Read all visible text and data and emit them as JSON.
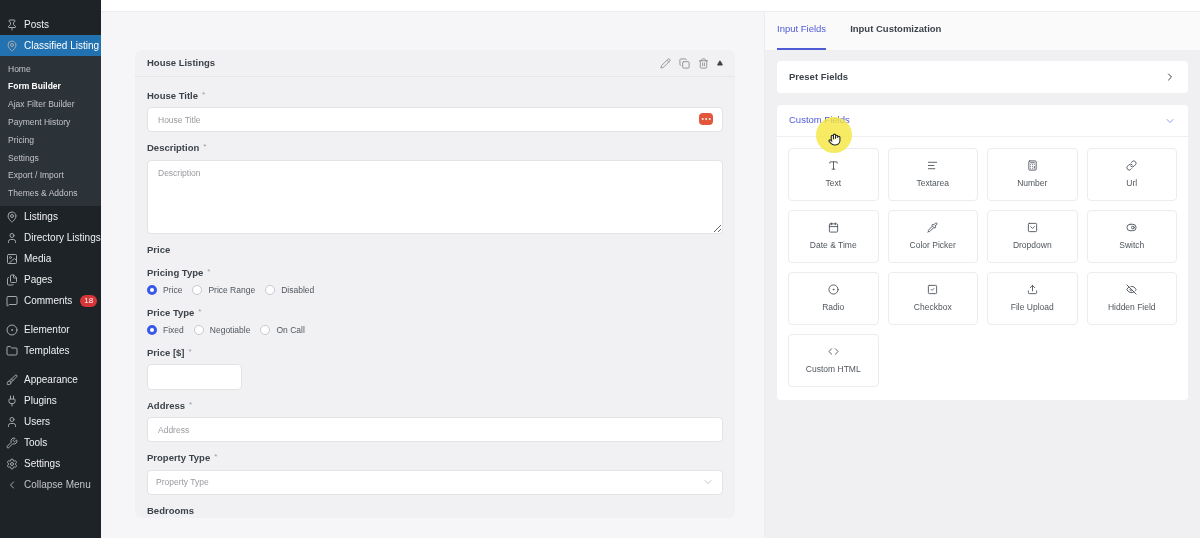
{
  "sidebar": {
    "items": [
      {
        "label": "Posts",
        "selected": false
      },
      {
        "label": "Classified Listing",
        "selected": true,
        "children": [
          {
            "label": "Home",
            "selected": false
          },
          {
            "label": "Form Builder",
            "selected": true
          },
          {
            "label": "Ajax Filter Builder",
            "selected": false
          },
          {
            "label": "Payment History",
            "selected": false
          },
          {
            "label": "Pricing",
            "selected": false
          },
          {
            "label": "Settings",
            "selected": false
          },
          {
            "label": "Export / Import",
            "selected": false
          },
          {
            "label": "Themes & Addons",
            "selected": false
          }
        ]
      },
      {
        "label": "Listings",
        "selected": false
      },
      {
        "label": "Directory Listings",
        "selected": false
      },
      {
        "label": "Media",
        "selected": false
      },
      {
        "label": "Pages",
        "selected": false
      },
      {
        "label": "Comments",
        "selected": false,
        "badge": "18"
      },
      {
        "label": "Elementor",
        "selected": false
      },
      {
        "label": "Templates",
        "selected": false
      },
      {
        "label": "Appearance",
        "selected": false
      },
      {
        "label": "Plugins",
        "selected": false
      },
      {
        "label": "Users",
        "selected": false
      },
      {
        "label": "Tools",
        "selected": false
      },
      {
        "label": "Settings",
        "selected": false
      },
      {
        "label": "Collapse Menu",
        "selected": false
      }
    ]
  },
  "form": {
    "title": "House Listings",
    "fields": [
      {
        "kind": "text",
        "label": "House Title",
        "required": "*",
        "placeholder": "House Title"
      },
      {
        "kind": "textarea",
        "label": "Description",
        "required": "*",
        "placeholder": "Description"
      },
      {
        "kind": "heading",
        "label": "Price"
      },
      {
        "kind": "radio",
        "label": "Pricing Type",
        "required": "*",
        "options": [
          {
            "label": "Price",
            "selected": true
          },
          {
            "label": "Price Range",
            "selected": false
          },
          {
            "label": "Disabled",
            "selected": false
          }
        ]
      },
      {
        "kind": "radio",
        "label": "Price Type",
        "required": "*",
        "options": [
          {
            "label": "Fixed",
            "selected": true
          },
          {
            "label": "Negotiable",
            "selected": false
          },
          {
            "label": "On Call",
            "selected": false
          }
        ]
      },
      {
        "kind": "small",
        "label": "Price [$]",
        "required": "*"
      },
      {
        "kind": "text",
        "label": "Address",
        "required": "*",
        "placeholder": "Address"
      },
      {
        "kind": "select",
        "label": "Property Type",
        "required": "*",
        "placeholder": "Property Type"
      },
      {
        "kind": "heading",
        "label": "Bedrooms"
      }
    ]
  },
  "panel": {
    "tabs": [
      {
        "label": "Input Fields",
        "selected": true
      },
      {
        "label": "Input Customization",
        "selected": false
      }
    ],
    "sections": [
      {
        "title": "Preset Fields",
        "expanded": false
      },
      {
        "title": "Custom Fields",
        "expanded": true,
        "items": [
          {
            "label": "Text"
          },
          {
            "label": "Textarea"
          },
          {
            "label": "Number"
          },
          {
            "label": "Url"
          },
          {
            "label": "Date & Time"
          },
          {
            "label": "Color Picker"
          },
          {
            "label": "Dropdown"
          },
          {
            "label": "Switch"
          },
          {
            "label": "Radio"
          },
          {
            "label": "Checkbox"
          },
          {
            "label": "File Upload"
          },
          {
            "label": "Hidden Field"
          },
          {
            "label": "Custom HTML"
          }
        ]
      }
    ]
  }
}
